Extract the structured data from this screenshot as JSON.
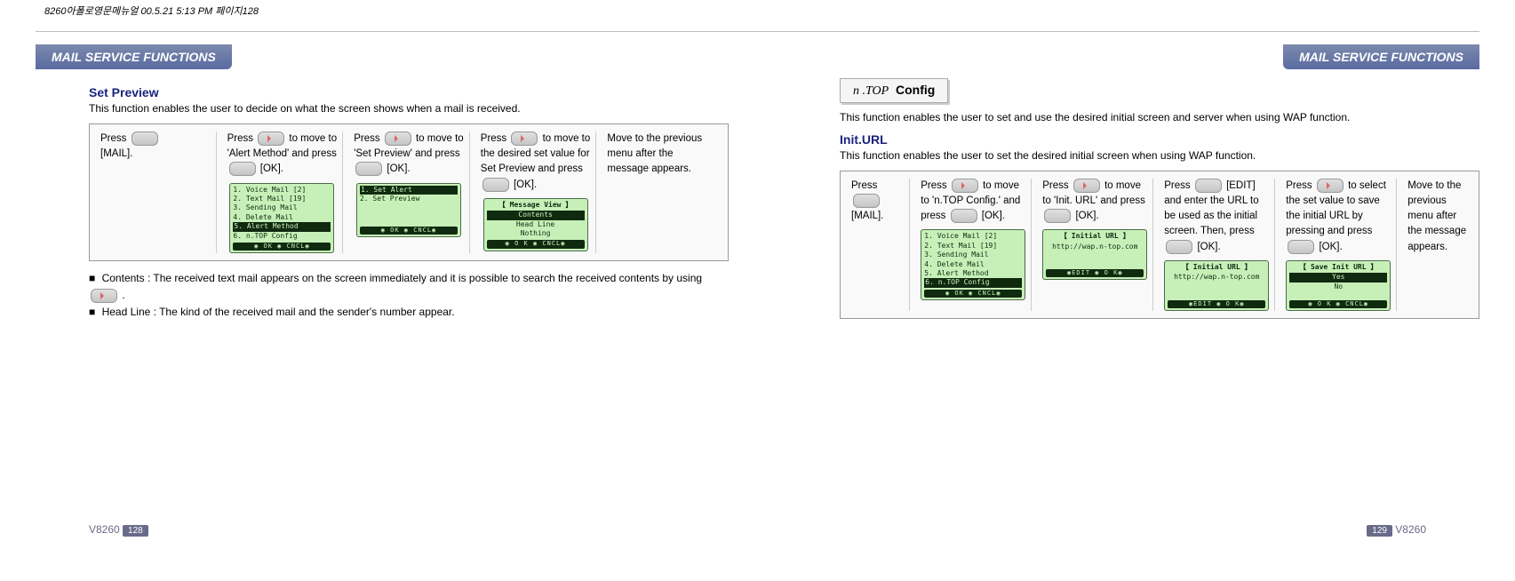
{
  "crop_text": "8260아폴로영문메뉴얼  00.5.21 5:13 PM  페이지128",
  "tab": "MAIL SERVICE FUNCTIONS",
  "left": {
    "title": "Set Preview",
    "intro": "This function enables  the user to  decide on what  the screen shows  when a mail  is received.",
    "steps": {
      "s1a": "Press ",
      "s1b": "[MAIL].",
      "s2a": "Press ",
      "s2b": " to move to  'Alert Method'  and press ",
      "s2c": " [OK].",
      "s3a": "Press ",
      "s3b": " to move to  'Set Preview'  and press ",
      "s3c": " [OK].",
      "s4a": "Press ",
      "s4b": " to move to the desired set value for Set Preview and press ",
      "s4c": " [OK].",
      "s5": "Move to the previous menu after the message appears."
    },
    "screens": {
      "a1": "1. Voice Mail [2]",
      "a2": "2. Text Mail [19]",
      "a3": "3. Sending Mail",
      "a4": "4. Delete Mail",
      "a5": "5. Alert Method",
      "a6": "6. n.TOP Config",
      "abar": "◉ OK   ◉ CNCL◉",
      "b1": "1. Set Alert",
      "b2": "2. Set Preview",
      "bbar": "◉ OK   ◉ CNCL◉",
      "ctitle": "【 Message View 】",
      "c1": "Contents",
      "c2": "Head Line",
      "c3": "Nothing",
      "cbar": "◉ O K   ◉ CNCL◉"
    },
    "bullets": {
      "b1": "Contents : The  received text mail  appears on the  screen immediately and  it is possible to search the received contents by using ",
      "b1end": " .",
      "b2": "Head Line : The kind of the received mail and the sender's number appear."
    },
    "footer_model": "V8260",
    "footer_page": "128"
  },
  "right": {
    "config_label_prefix": "n .TOP",
    "config_label_bold": "Config",
    "intro": "This function enables the user to set and use the desired initial screen and server when using WAP function.",
    "subtitle": "Init.URL",
    "subintro": "This function  enables the  user  to set  the desired  initial  screen when  using WAP function.",
    "steps": {
      "s1a": "Press ",
      "s1b": "[MAIL].",
      "s2a": "Press ",
      "s2b": " to move to  'n.TOP Config.'  and press ",
      "s2c": " [OK].",
      "s3a": "Press ",
      "s3b": " to move to  'Init. URL'  and press ",
      "s3c": " [OK].",
      "s4a": "Press ",
      "s4b": " [EDIT] and enter the URL to be used  as the initial screen. Then, press ",
      "s4c": " [OK].",
      "s5a": "Press ",
      "s5b": " to  select the set  value to save the initial URL  by pressing and  press ",
      "s5c": " [OK].",
      "s6": "Move to the previous menu after the message appears."
    },
    "screens": {
      "a1": "1. Voice Mail [2]",
      "a2": "2. Text Mail [19]",
      "a3": "3. Sending Mail",
      "a4": "4. Delete Mail",
      "a5": "5. Alert Method",
      "a6": "6. n.TOP Config",
      "abar": "◉ OK   ◉ CNCL◉",
      "btitle": "【 Initial URL 】",
      "b1": "http://wap.n-top.com",
      "bbar": "◉EDIT  ◉  O K◉",
      "ctitle": "【 Initial URL 】",
      "c1": "http://wap.n-top.com",
      "cbar": "◉EDIT  ◉  O K◉",
      "dtitle": "【 Save Init URL 】",
      "d1": "Yes",
      "d2": "No",
      "dbar": "◉ O K   ◉ CNCL◉"
    },
    "footer_model": "V8260",
    "footer_page": "129"
  }
}
